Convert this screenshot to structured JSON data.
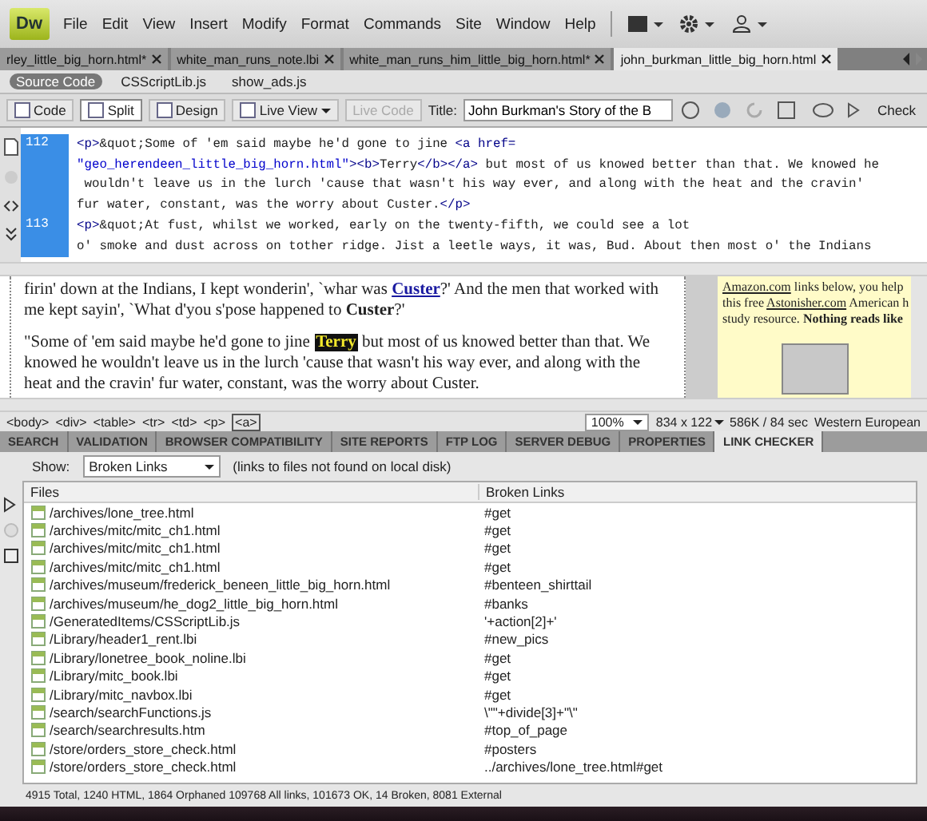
{
  "app": {
    "logo": "Dw",
    "menu": [
      "File",
      "Edit",
      "View",
      "Insert",
      "Modify",
      "Format",
      "Commands",
      "Site",
      "Window",
      "Help"
    ]
  },
  "doc_tabs": [
    {
      "label": "rley_little_big_horn.html*",
      "selected": false
    },
    {
      "label": "white_man_runs_note.lbi",
      "selected": false
    },
    {
      "label": "white_man_runs_him_little_big_horn.html*",
      "selected": false
    },
    {
      "label": "john_burkman_little_big_horn.html",
      "selected": true
    }
  ],
  "related_files": [
    {
      "label": "Source Code",
      "selected": true
    },
    {
      "label": "CSScriptLib.js",
      "selected": false
    },
    {
      "label": "show_ads.js",
      "selected": false
    }
  ],
  "toolbar": {
    "views": [
      {
        "label": "Code",
        "selected": false
      },
      {
        "label": "Split",
        "selected": true
      },
      {
        "label": "Design",
        "selected": false
      }
    ],
    "live_view": "Live View",
    "live_code": {
      "label": "Live Code",
      "disabled": true
    },
    "title_label": "Title:",
    "title_value": "John Burkman's Story of the B",
    "check": "Check"
  },
  "code_view": {
    "lines": [
      {
        "number": "112",
        "segments": [
          {
            "kind": "tag",
            "text": "<p>"
          },
          {
            "kind": "text",
            "text": "&quot;Some of 'em said maybe he'd gone to jine "
          },
          {
            "kind": "tag",
            "text": "<a href="
          }
        ]
      },
      {
        "segments": [
          {
            "kind": "attr",
            "text": "\"geo_herendeen_little_big_horn.html\""
          },
          {
            "kind": "tag",
            "text": ">"
          },
          {
            "kind": "tag",
            "text": "<b>"
          },
          {
            "kind": "text",
            "text": "Terry"
          },
          {
            "kind": "tag",
            "text": "</b></a>"
          },
          {
            "kind": "text",
            "text": " but most of us knowed better than that. We knowed he"
          }
        ]
      },
      {
        "segments": [
          {
            "kind": "text",
            "text": " wouldn't leave us in the lurch 'cause that wasn't his way ever, and along with the heat and the cravin'"
          }
        ]
      },
      {
        "segments": [
          {
            "kind": "text",
            "text": "fur water, constant, was the worry about Custer."
          },
          {
            "kind": "tag",
            "text": "</p>"
          }
        ]
      },
      {
        "number": "113",
        "segments": [
          {
            "kind": "tag",
            "text": "<p>"
          },
          {
            "kind": "text",
            "text": "&quot;At fust, whilst we worked, early on the twenty-fifth, we could see a lot"
          }
        ]
      },
      {
        "segments": [
          {
            "kind": "text",
            "text": "o' smoke and dust across on tother ridge. Jist a leetle ways, it was, Bud. About then most o' the Indians"
          }
        ]
      }
    ]
  },
  "design_view": {
    "paragraphs": [
      [
        {
          "kind": "text",
          "text": "firin' down at the Indians, I kept wonderin', `whar was "
        },
        {
          "kind": "link",
          "text": "Custer"
        },
        {
          "kind": "text",
          "text": "?' And the men that worked with me kept sayin', `What d'you s'pose happened to "
        },
        {
          "kind": "bold",
          "text": "Custer"
        },
        {
          "kind": "text",
          "text": "?'"
        }
      ],
      [
        {
          "kind": "text",
          "text": "\"Some of 'em said maybe he'd gone to jine "
        },
        {
          "kind": "highlight",
          "text": "Terry"
        },
        {
          "kind": "text",
          "text": " but most of us knowed better than that. We knowed he wouldn't leave us in the lurch 'cause that wasn't his way ever, and along with the heat and the cravin' fur water, constant, was the worry about Custer."
        }
      ]
    ],
    "side_lines": [
      [
        {
          "kind": "link",
          "text": "Amazon.com"
        },
        {
          "kind": "text",
          "text": " links below, you help"
        }
      ],
      [
        {
          "kind": "text",
          "text": "this free "
        },
        {
          "kind": "link",
          "text": "Astonisher.com"
        },
        {
          "kind": "text",
          "text": " American h"
        }
      ],
      [
        {
          "kind": "text",
          "text": "study resource. "
        },
        {
          "kind": "bold",
          "text": "Nothing reads like"
        }
      ]
    ]
  },
  "tag_selector": {
    "tags": [
      {
        "label": "<body>",
        "selected": false
      },
      {
        "label": "<div>",
        "selected": false
      },
      {
        "label": "<table>",
        "selected": false
      },
      {
        "label": "<tr>",
        "selected": false
      },
      {
        "label": "<td>",
        "selected": false
      },
      {
        "label": "<p>",
        "selected": false
      },
      {
        "label": "<a>",
        "selected": true
      }
    ],
    "zoom": "100%",
    "size": "834 x 122",
    "download": "586K / 84 sec",
    "encoding": "Western European"
  },
  "panel": {
    "tabs": [
      {
        "label": "SEARCH",
        "selected": false
      },
      {
        "label": "VALIDATION",
        "selected": false
      },
      {
        "label": "BROWSER COMPATIBILITY",
        "selected": false
      },
      {
        "label": "SITE REPORTS",
        "selected": false
      },
      {
        "label": "FTP LOG",
        "selected": false
      },
      {
        "label": "SERVER DEBUG",
        "selected": false
      },
      {
        "label": "PROPERTIES",
        "selected": false
      },
      {
        "label": "LINK CHECKER",
        "selected": true
      }
    ],
    "show_label": "Show:",
    "show_value": "Broken Links",
    "show_hint": "(links to files not found on local disk)",
    "columns": [
      "Files",
      "Broken Links"
    ],
    "rows": [
      [
        "/archives/lone_tree.html",
        "#get"
      ],
      [
        "/archives/mitc/mitc_ch1.html",
        "#get"
      ],
      [
        "/archives/mitc/mitc_ch1.html",
        "#get"
      ],
      [
        "/archives/mitc/mitc_ch1.html",
        "#get"
      ],
      [
        "/archives/museum/frederick_beneen_little_big_horn.html",
        "#benteen_shirttail"
      ],
      [
        "/archives/museum/he_dog2_little_big_horn.html",
        "#banks"
      ],
      [
        "/GeneratedItems/CSScriptLib.js",
        "'+action[2]+'"
      ],
      [
        "/Library/header1_rent.lbi",
        "#new_pics"
      ],
      [
        "/Library/lonetree_book_noline.lbi",
        "#get"
      ],
      [
        "/Library/mitc_book.lbi",
        "#get"
      ],
      [
        "/Library/mitc_navbox.lbi",
        "#get"
      ],
      [
        "/search/searchFunctions.js",
        "\\\"\"+divide[3]+\"\\\""
      ],
      [
        "/search/searchresults.htm",
        "#top_of_page"
      ],
      [
        "/store/orders_store_check.html",
        "#posters"
      ],
      [
        "/store/orders_store_check.html",
        "../archives/lone_tree.html#get"
      ]
    ],
    "status": "4915 Total, 1240 HTML, 1864 Orphaned 109768 All links, 101673 OK, 14 Broken, 8081 External"
  }
}
